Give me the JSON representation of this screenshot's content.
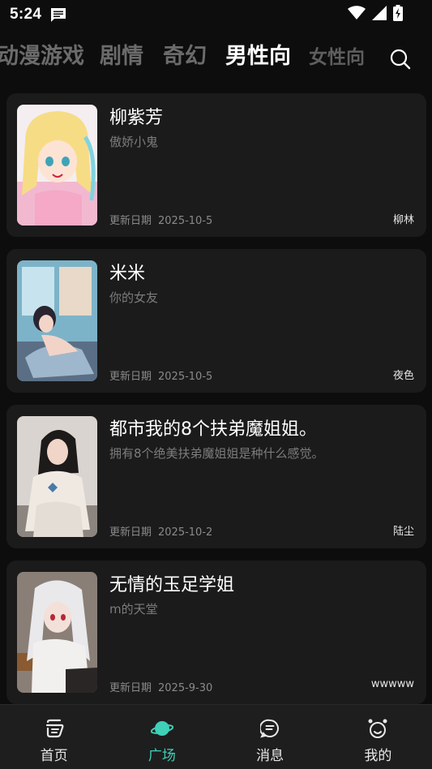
{
  "status": {
    "time": "5:24"
  },
  "tabs": [
    {
      "label": "动漫游戏"
    },
    {
      "label": "剧情"
    },
    {
      "label": "奇幻"
    },
    {
      "label": "男性向"
    },
    {
      "label": "女性向"
    }
  ],
  "cards": [
    {
      "title": "柳紫芳",
      "subtitle": "傲娇小鬼",
      "date_label": "更新日期",
      "date": "2025-10-5",
      "author": "柳林"
    },
    {
      "title": "米米",
      "subtitle": "你的女友",
      "date_label": "更新日期",
      "date": "2025-10-5",
      "author": "夜色"
    },
    {
      "title": "都市我的8个扶弟魔姐姐。",
      "subtitle": "拥有8个绝美扶弟魔姐姐是种什么感觉。",
      "date_label": "更新日期",
      "date": "2025-10-2",
      "author": "陆尘"
    },
    {
      "title": "无情的玉足学姐",
      "subtitle": "m的天堂",
      "date_label": "更新日期",
      "date": "2025-9-30",
      "author": "wwwww"
    }
  ],
  "nav": [
    {
      "label": "首页",
      "icon": "home-icon"
    },
    {
      "label": "广场",
      "icon": "planet-icon"
    },
    {
      "label": "消息",
      "icon": "message-icon"
    },
    {
      "label": "我的",
      "icon": "profile-icon"
    }
  ],
  "colors": {
    "accent": "#3fd0b8",
    "background": "#0d0d0d",
    "card": "#1b1b1b"
  }
}
